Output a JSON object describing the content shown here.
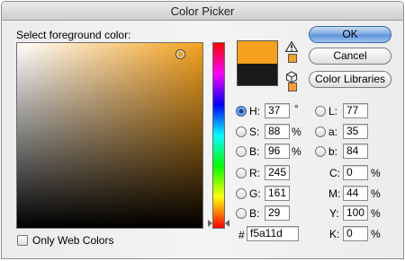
{
  "window": {
    "title": "Color Picker"
  },
  "picker": {
    "prompt": "Select foreground color:",
    "current_color": "#f5a11d",
    "original_color": "#1a1a1a"
  },
  "buttons": {
    "ok": "OK",
    "cancel": "Cancel",
    "libraries": "Color Libraries"
  },
  "fields": {
    "h": {
      "label": "H:",
      "value": "37",
      "unit": "°",
      "selected": true
    },
    "s": {
      "label": "S:",
      "value": "88",
      "unit": "%"
    },
    "b": {
      "label": "B:",
      "value": "96",
      "unit": "%"
    },
    "r": {
      "label": "R:",
      "value": "245"
    },
    "g": {
      "label": "G:",
      "value": "161"
    },
    "bl": {
      "label": "B:",
      "value": "29"
    },
    "l": {
      "label": "L:",
      "value": "77"
    },
    "a": {
      "label": "a:",
      "value": "35"
    },
    "lab_b": {
      "label": "b:",
      "value": "84"
    },
    "c": {
      "label": "C:",
      "value": "0",
      "unit": "%"
    },
    "m": {
      "label": "M:",
      "value": "44",
      "unit": "%"
    },
    "y": {
      "label": "Y:",
      "value": "100",
      "unit": "%"
    },
    "k": {
      "label": "K:",
      "value": "0",
      "unit": "%"
    },
    "hex": {
      "label": "#",
      "value": "f5a11d"
    }
  },
  "options": {
    "only_web_colors": "Only Web Colors"
  },
  "icons": {
    "warning": "gamut-warning-icon",
    "web_safe": "web-safe-cube-icon"
  },
  "colors": {
    "gamut_swatch": "#f2a224",
    "web_swatch": "#ff9933"
  }
}
